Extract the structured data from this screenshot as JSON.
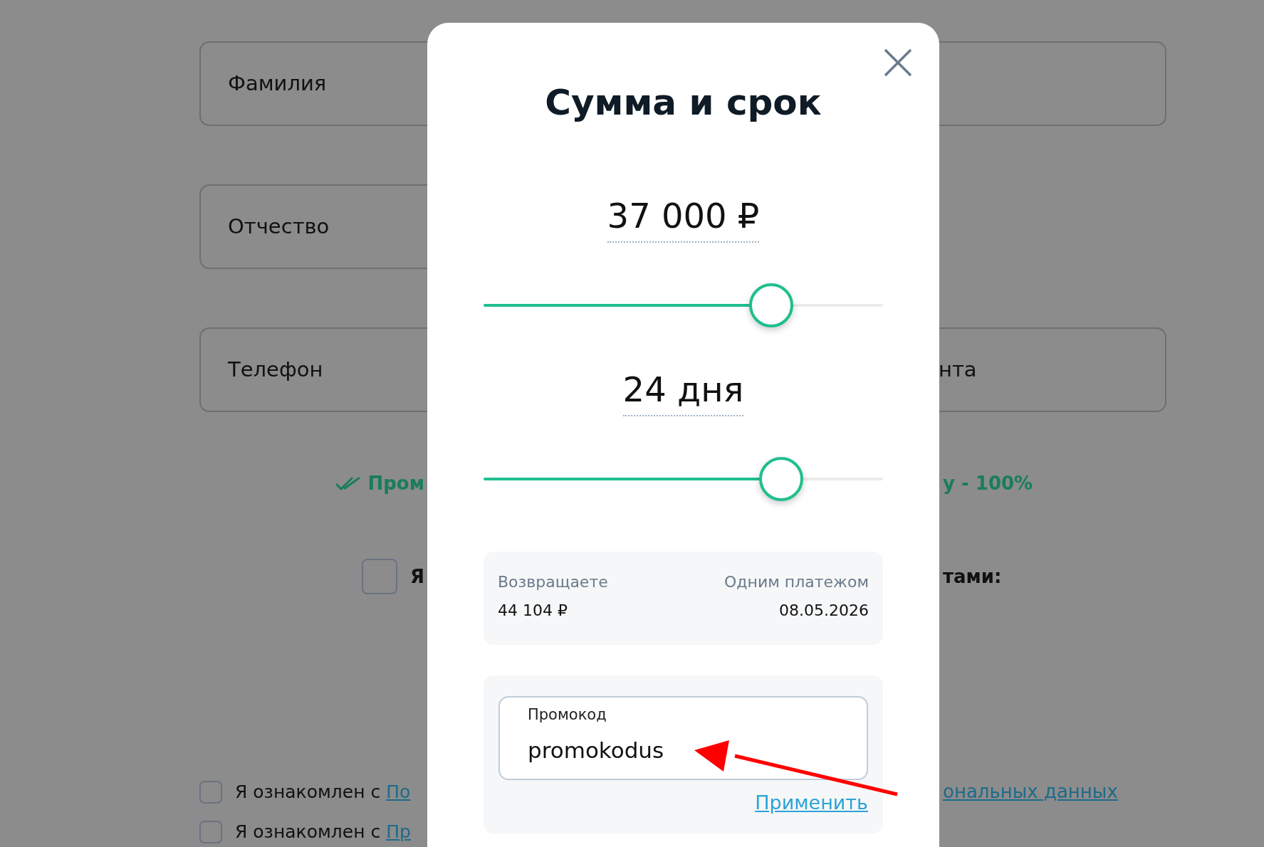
{
  "background": {
    "fields_left": [
      "Фамилия",
      "Отчество",
      "Телефон"
    ],
    "field_right_partial": "нта",
    "promo_status": {
      "left": "Пром",
      "right": "у - 100%"
    },
    "consent": {
      "checked": false,
      "left": "Я",
      "right": "тами:"
    },
    "agreements": [
      {
        "checked": false,
        "text": "Я ознакомлен с",
        "link": "По",
        "link_right": "ональных данных"
      },
      {
        "checked": false,
        "text": "Я ознакомлен с",
        "link": "Пр"
      }
    ]
  },
  "modal": {
    "title": "Сумма и срок",
    "amount": {
      "value": "37 000",
      "unit": "₽",
      "level": 0.72
    },
    "term": {
      "value": "24",
      "unit": "дня",
      "level": 0.745
    },
    "summary": {
      "return_label": "Возвращаете",
      "return_value": "44 104 ₽",
      "payment_label": "Одним платежом",
      "payment_date": "08.05.2026"
    },
    "promo": {
      "label": "Промокод",
      "value": "promokodus",
      "apply_link": "Применить"
    }
  }
}
